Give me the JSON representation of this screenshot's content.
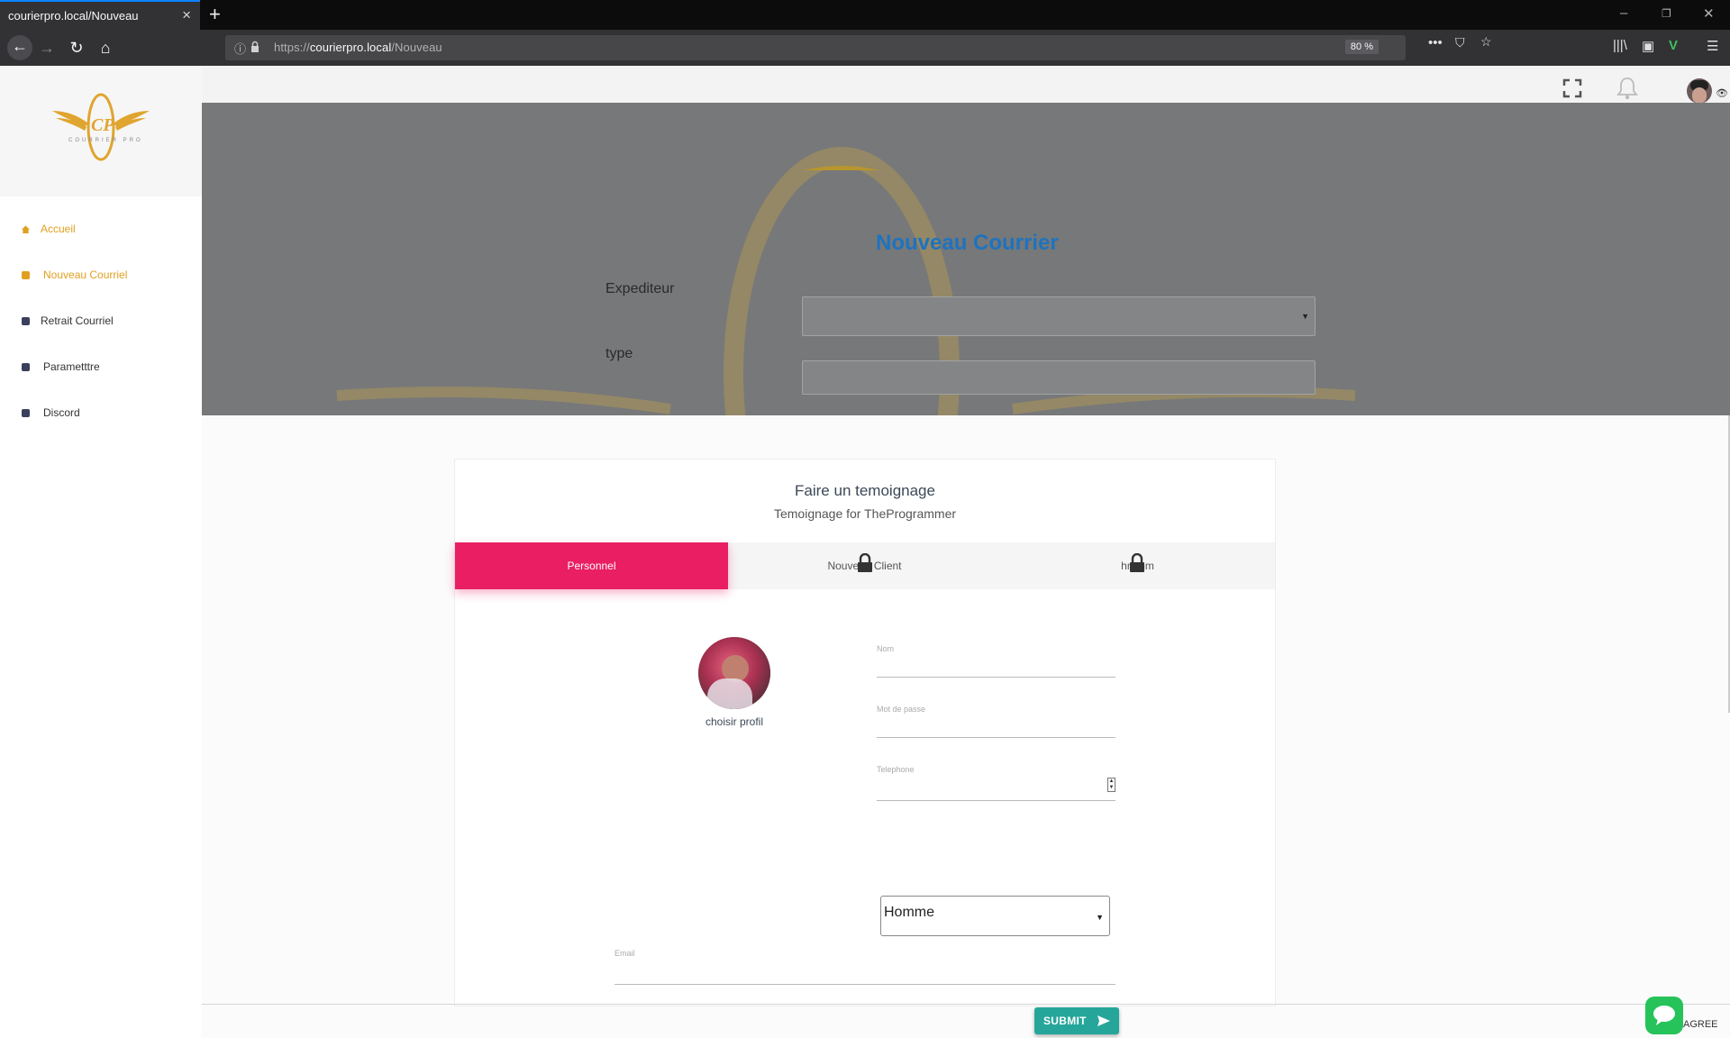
{
  "browser": {
    "tab_title": "courierpro.local/Nouveau",
    "url_prefix": "https://",
    "url_domain": "courierpro.local",
    "url_path": "/Nouveau",
    "zoom": "80 %"
  },
  "sidebar": {
    "items": [
      {
        "label": "Accueil",
        "icon": "home-icon",
        "active": true
      },
      {
        "label": "Nouveau Courriel",
        "icon": "document-icon",
        "active": true
      },
      {
        "label": "Retrait Courriel",
        "icon": "document-icon",
        "active": false
      },
      {
        "label": "Parametttre",
        "icon": "document-icon",
        "active": false
      },
      {
        "label": "Discord",
        "icon": "document-icon",
        "active": false
      }
    ]
  },
  "hero": {
    "title": "Nouveau Courrier",
    "expediteur_label": "Expediteur",
    "type_label": "type"
  },
  "card": {
    "title": "Faire un temoignage",
    "subtitle": "Temoignage for TheProgrammer",
    "tabs": [
      {
        "label": "Personnel",
        "locked": false,
        "active": true
      },
      {
        "label": "Nouveau Client",
        "locked": true,
        "active": false
      },
      {
        "label": "hmmm",
        "locked": true,
        "active": false
      }
    ],
    "avatar_caption": "choisir profil",
    "fields": {
      "nom": "Nom",
      "mot_de_passe": "Mot de passe",
      "telephone": "Telephone",
      "email": "Email"
    },
    "gender_value": "Homme",
    "submit_label": "SUBMIT"
  },
  "footer": {
    "agree": "AGREE"
  },
  "colors": {
    "accent_pink": "#e91e63",
    "title_blue": "#1e73be",
    "submit_teal": "#26a69a",
    "sidebar_active": "#e0a020"
  }
}
